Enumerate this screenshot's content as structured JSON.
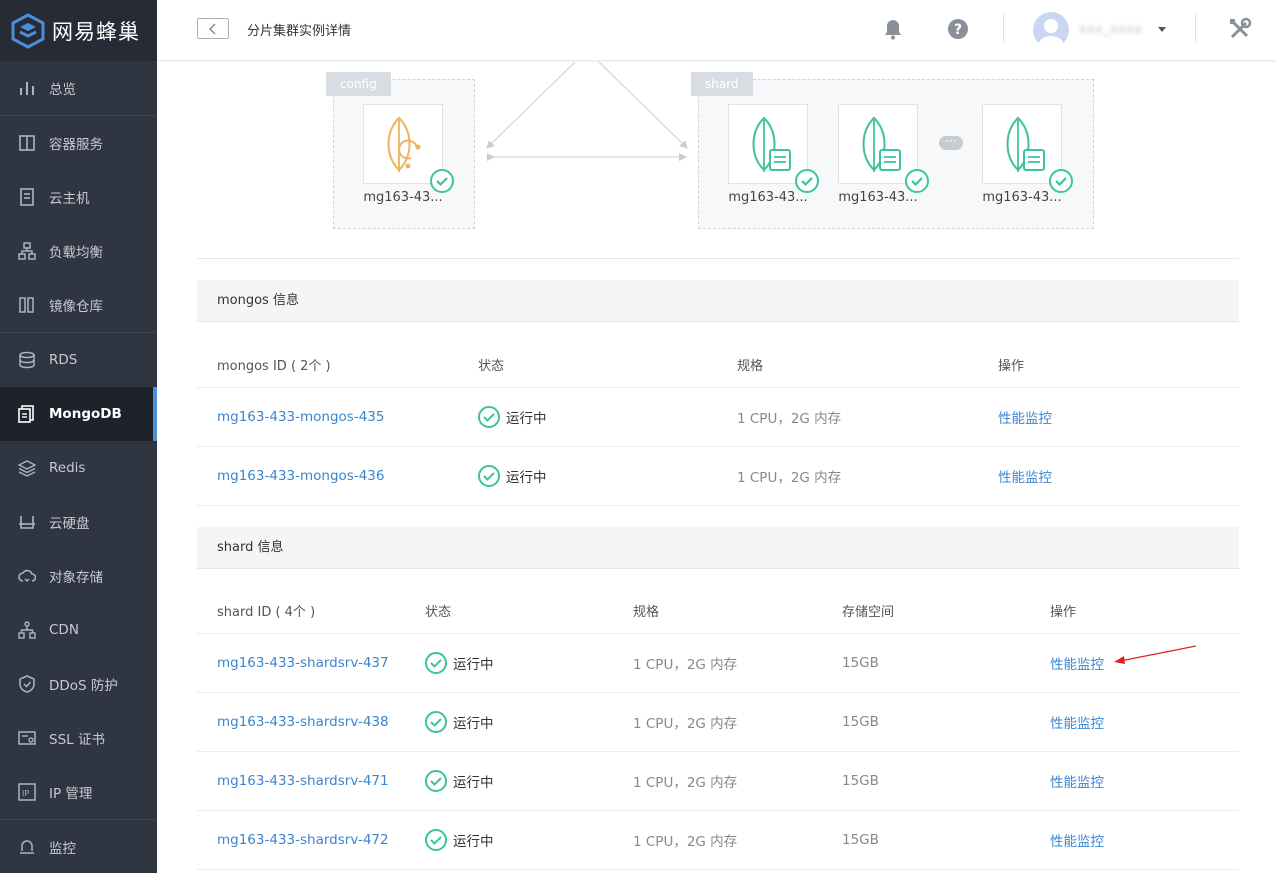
{
  "app": {
    "name": "网易蜂巢"
  },
  "sidebar": {
    "items": [
      {
        "label": "总览",
        "icon": "bar-chart-icon"
      },
      {
        "label": "容器服务",
        "icon": "container-icon"
      },
      {
        "label": "云主机",
        "icon": "server-icon"
      },
      {
        "label": "负载均衡",
        "icon": "network-icon"
      },
      {
        "label": "镜像仓库",
        "icon": "image-repo-icon"
      },
      {
        "label": "RDS",
        "icon": "database-icon"
      },
      {
        "label": "MongoDB",
        "icon": "mongodb-icon",
        "active": true
      },
      {
        "label": "Redis",
        "icon": "layers-icon"
      },
      {
        "label": "云硬盘",
        "icon": "disk-icon"
      },
      {
        "label": "对象存储",
        "icon": "cloud-icon"
      },
      {
        "label": "CDN",
        "icon": "cdn-icon"
      },
      {
        "label": "DDoS 防护",
        "icon": "shield-icon"
      },
      {
        "label": "SSL 证书",
        "icon": "certificate-icon"
      },
      {
        "label": "IP 管理",
        "icon": "ip-icon"
      },
      {
        "label": "监控",
        "icon": "monitor-bell-icon"
      }
    ]
  },
  "header": {
    "title": "分片集群实例详情",
    "username": "xxx_xxxx"
  },
  "topology": {
    "config": {
      "tag": "config",
      "nodes": [
        "mg163-43..."
      ]
    },
    "shard": {
      "tag": "shard",
      "nodes": [
        "mg163-43...",
        "mg163-43...",
        "mg163-43..."
      ]
    }
  },
  "mongos": {
    "section_title": "mongos 信息",
    "headers": [
      "mongos ID ( 2个 )",
      "状态",
      "规格",
      "操作"
    ],
    "rows": [
      {
        "id": "mg163-433-mongos-435",
        "status": "运行中",
        "spec": "1 CPU，2G 内存",
        "action": "性能监控"
      },
      {
        "id": "mg163-433-mongos-436",
        "status": "运行中",
        "spec": "1 CPU，2G 内存",
        "action": "性能监控"
      }
    ]
  },
  "shard": {
    "section_title": "shard 信息",
    "headers": [
      "shard ID ( 4个 )",
      "状态",
      "规格",
      "存储空间",
      "操作"
    ],
    "rows": [
      {
        "id": "mg163-433-shardsrv-437",
        "status": "运行中",
        "spec": "1 CPU，2G 内存",
        "storage": "15GB",
        "action": "性能监控"
      },
      {
        "id": "mg163-433-shardsrv-438",
        "status": "运行中",
        "spec": "1 CPU，2G 内存",
        "storage": "15GB",
        "action": "性能监控"
      },
      {
        "id": "mg163-433-shardsrv-471",
        "status": "运行中",
        "spec": "1 CPU，2G 内存",
        "storage": "15GB",
        "action": "性能监控"
      },
      {
        "id": "mg163-433-shardsrv-472",
        "status": "运行中",
        "spec": "1 CPU，2G 内存",
        "storage": "15GB",
        "action": "性能监控"
      }
    ]
  },
  "colors": {
    "accent": "#3b85d0",
    "success": "#3cc39e",
    "sidebar_bg": "#2f3541",
    "config_leaf": "#f0b25a"
  }
}
